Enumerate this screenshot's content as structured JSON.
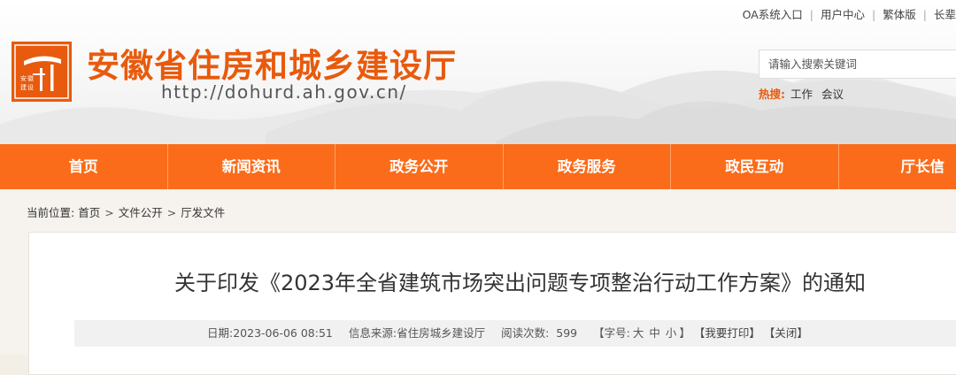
{
  "top_links": [
    "OA系统入口",
    "用户中心",
    "繁体版",
    "长辈"
  ],
  "site": {
    "title": "安徽省住房和城乡建设厅",
    "url": "http://dohurd.ah.gov.cn/",
    "logo_text": [
      "安",
      "徽",
      "建",
      "设"
    ]
  },
  "search": {
    "placeholder": "请输入搜索关键词",
    "hot_label": "热搜:",
    "hot_items": [
      "工作",
      "会议"
    ]
  },
  "nav": [
    "首页",
    "新闻资讯",
    "政务公开",
    "政务服务",
    "政民互动",
    "厅长信"
  ],
  "breadcrumb": {
    "label": "当前位置:",
    "items": [
      "首页",
      "文件公开",
      "厅发文件"
    ],
    "separator": ">"
  },
  "article": {
    "title": "关于印发《2023年全省建筑市场突出问题专项整治行动工作方案》的通知",
    "date_label": "日期:",
    "date": "2023-06-06 08:51",
    "source_label": "信息来源:",
    "source": "省住房城乡建设厅",
    "views_label": "阅读次数:",
    "views": "599",
    "font_label": "【字号:",
    "font_sizes": [
      "大",
      "中",
      "小"
    ],
    "font_close": "】",
    "print": "【我要打印】",
    "close": "【关闭】"
  },
  "colors": {
    "brand_orange": "#fb6c1a",
    "title_orange": "#e85a0d"
  }
}
